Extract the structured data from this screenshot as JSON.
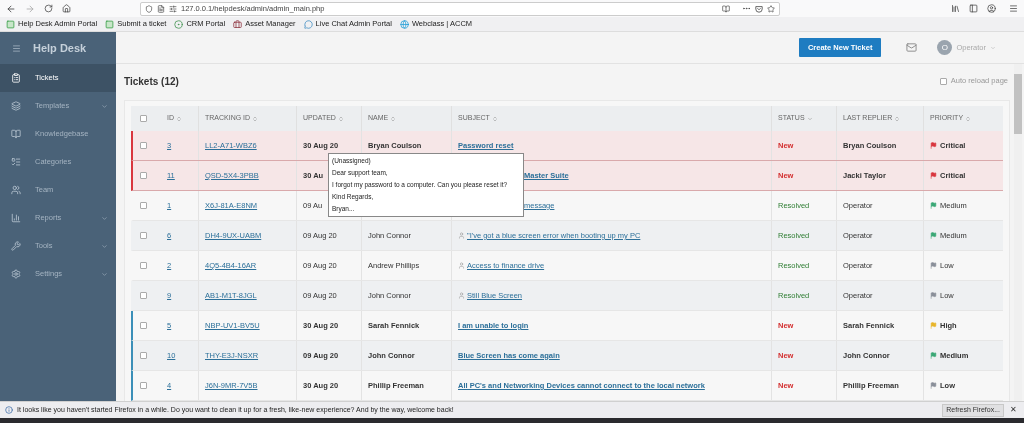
{
  "browser": {
    "url": "127.0.0.1/helpdesk/admin/admin_main.php",
    "bookmarks": [
      {
        "label": "Help Desk Admin Portal",
        "kind": "hd"
      },
      {
        "label": "Submit a ticket",
        "kind": "hd"
      },
      {
        "label": "CRM Portal",
        "kind": "crm"
      },
      {
        "label": "Asset Manager",
        "kind": "asset"
      },
      {
        "label": "Live Chat Admin Portal",
        "kind": "chat"
      },
      {
        "label": "Webclass | ACCM",
        "kind": "web"
      }
    ]
  },
  "sidebar": {
    "title": "Help Desk",
    "items": [
      {
        "label": "Tickets",
        "selected": true,
        "submenu": false
      },
      {
        "label": "Templates",
        "selected": false,
        "submenu": true
      },
      {
        "label": "Knowledgebase",
        "selected": false,
        "submenu": false
      },
      {
        "label": "Categories",
        "selected": false,
        "submenu": false
      },
      {
        "label": "Team",
        "selected": false,
        "submenu": false
      },
      {
        "label": "Reports",
        "selected": false,
        "submenu": true
      },
      {
        "label": "Tools",
        "selected": false,
        "submenu": true
      },
      {
        "label": "Settings",
        "selected": false,
        "submenu": true
      }
    ]
  },
  "header": {
    "create_button": "Create New Ticket",
    "avatar": "O",
    "user": "Operator"
  },
  "page": {
    "title": "Tickets (12)",
    "auto_reload": {
      "label": "Auto reload page",
      "checked": false
    }
  },
  "table": {
    "select_all_checked": false,
    "columns": [
      "ID",
      "TRACKING ID",
      "UPDATED",
      "NAME",
      "SUBJECT",
      "STATUS",
      "LAST REPLIER",
      "PRIORITY"
    ],
    "rows": [
      {
        "checked": false,
        "highlighted": true,
        "unread": false,
        "id": "3",
        "tracking_id": "LL2-A71-WBZ6",
        "updated": "30 Aug 20",
        "name": "Bryan Coulson",
        "subject": "Password reset",
        "owner_icon": false,
        "status": "New",
        "kind": "new",
        "last_replier": "Bryan Coulson",
        "priority": "Critical",
        "color": "#d9363e"
      },
      {
        "checked": false,
        "highlighted": true,
        "unread": false,
        "id": "11",
        "tracking_id": "QSD-5X4-3PBB",
        "updated": "30 Au",
        "subject": "Master Suite",
        "owner_icon": false,
        "status": "New",
        "kind": "new",
        "last_replier": "Jacki Taylor",
        "priority": "Critical",
        "color": "#d9363e"
      },
      {
        "checked": false,
        "highlighted": false,
        "unread": false,
        "id": "1",
        "tracking_id": "X6J-81A-E8NM",
        "updated": "09 Au",
        "subject": "message",
        "owner_icon": false,
        "status": "Resolved",
        "kind": "resolved",
        "last_replier": "Operator",
        "priority": "Medium",
        "color": "#3aa876"
      },
      {
        "checked": false,
        "highlighted": false,
        "unread": false,
        "id": "6",
        "tracking_id": "DH4-9UX-UABM",
        "updated": "09 Aug 20",
        "name": "John Connor",
        "subject": "\"I've got a blue screen error when booting up my PC",
        "owner_icon": true,
        "status": "Resolved",
        "kind": "resolved",
        "last_replier": "Operator",
        "priority": "Medium",
        "color": "#3aa876"
      },
      {
        "checked": false,
        "highlighted": false,
        "unread": false,
        "id": "2",
        "tracking_id": "4Q5-4B4-16AR",
        "updated": "09 Aug 20",
        "name": "Andrew Phillips",
        "subject": "Access to finance drive",
        "owner_icon": true,
        "status": "Resolved",
        "kind": "resolved",
        "last_replier": "Operator",
        "priority": "Low",
        "color": "#8a8f99"
      },
      {
        "checked": false,
        "highlighted": false,
        "unread": false,
        "id": "9",
        "tracking_id": "AB1-M1T-8JGL",
        "updated": "09 Aug 20",
        "name": "John Connor",
        "subject": "Still Blue Screen",
        "owner_icon": true,
        "status": "Resolved",
        "kind": "resolved",
        "last_replier": "Operator",
        "priority": "Low",
        "color": "#8a8f99"
      },
      {
        "checked": false,
        "highlighted": false,
        "unread": true,
        "id": "5",
        "tracking_id": "NBP-UV1-BV5U",
        "updated": "30 Aug 20",
        "name": "Sarah Fennick",
        "subject": "I am unable to login",
        "owner_icon": false,
        "status": "New",
        "kind": "new",
        "last_replier": "Sarah Fennick",
        "priority": "High",
        "color": "#e8b52a"
      },
      {
        "checked": false,
        "highlighted": false,
        "unread": true,
        "id": "10",
        "tracking_id": "THY-E3J-NSXR",
        "updated": "09 Aug 20",
        "name": "John Connor",
        "subject": "Blue Screen has come again",
        "owner_icon": false,
        "status": "New",
        "kind": "new",
        "last_replier": "John Connor",
        "priority": "Medium",
        "color": "#3aa876"
      },
      {
        "checked": false,
        "highlighted": false,
        "unread": true,
        "id": "4",
        "tracking_id": "J6N-9MR-7V5B",
        "updated": "30 Aug 20",
        "name": "Phillip Freeman",
        "subject": "All PC's and Networking Devices cannot connect to the local network",
        "owner_icon": false,
        "status": "New",
        "kind": "new",
        "last_replier": "Phillip Freeman",
        "priority": "Low",
        "color": "#8a8f99"
      }
    ]
  },
  "tooltip": [
    "(Unassigned)",
    "Dear support team,",
    "I forgot my password to a computer. Can you please reset it?",
    "Kind Regards,",
    "Bryan..."
  ],
  "notification": {
    "text": "It looks like you haven't started Firefox in a while. Do you want to clean it up for a fresh, like-new experience? And by the way, welcome back!",
    "button": "Refresh Firefox...",
    "close": "✕"
  }
}
